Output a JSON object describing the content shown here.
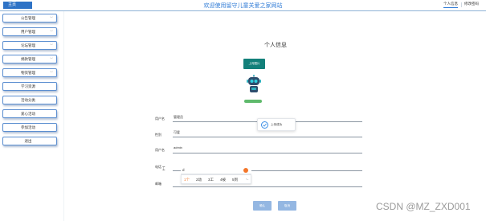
{
  "header": {
    "brand_label": "主页",
    "site_title": "欢迎使用留守儿童关爱之家网站",
    "links": [
      "个人信息",
      "修改密码"
    ],
    "accent_color": "#2f7bd6"
  },
  "sidebar": {
    "items": [
      {
        "label": "公告管理",
        "has_caret": true
      },
      {
        "label": "用户管理",
        "has_caret": true
      },
      {
        "label": "论坛管理",
        "has_caret": true
      },
      {
        "label": "捐款管理",
        "has_caret": true
      },
      {
        "label": "物资管理",
        "has_caret": true
      },
      {
        "label": "学习资源",
        "has_caret": false
      },
      {
        "label": "活动分类",
        "has_caret": false
      },
      {
        "label": "爱心活动",
        "has_caret": false
      },
      {
        "label": "参加活动",
        "has_caret": false
      },
      {
        "label": "退出",
        "has_caret": false
      }
    ]
  },
  "profile": {
    "title": "个人信息",
    "upload_label": "上传图片",
    "avatar_icon": "robot-avatar-icon",
    "avatar_badge": "",
    "fields": [
      {
        "label": "用户名",
        "value": "管理员"
      },
      {
        "label": "性别",
        "value": "可爱"
      },
      {
        "label": "用户名",
        "value": "admin"
      },
      {
        "label": "电话",
        "value": "d"
      },
      {
        "label": "邮箱",
        "value": ""
      }
    ],
    "toast": "上传成功",
    "ime": {
      "typed": "d",
      "candidates": [
        "1个",
        "2动",
        "3工",
        "4被",
        "5到"
      ]
    },
    "confirm_label": "确认",
    "cancel_label": "取消"
  },
  "watermark": "CSDN @MZ_ZXD001"
}
